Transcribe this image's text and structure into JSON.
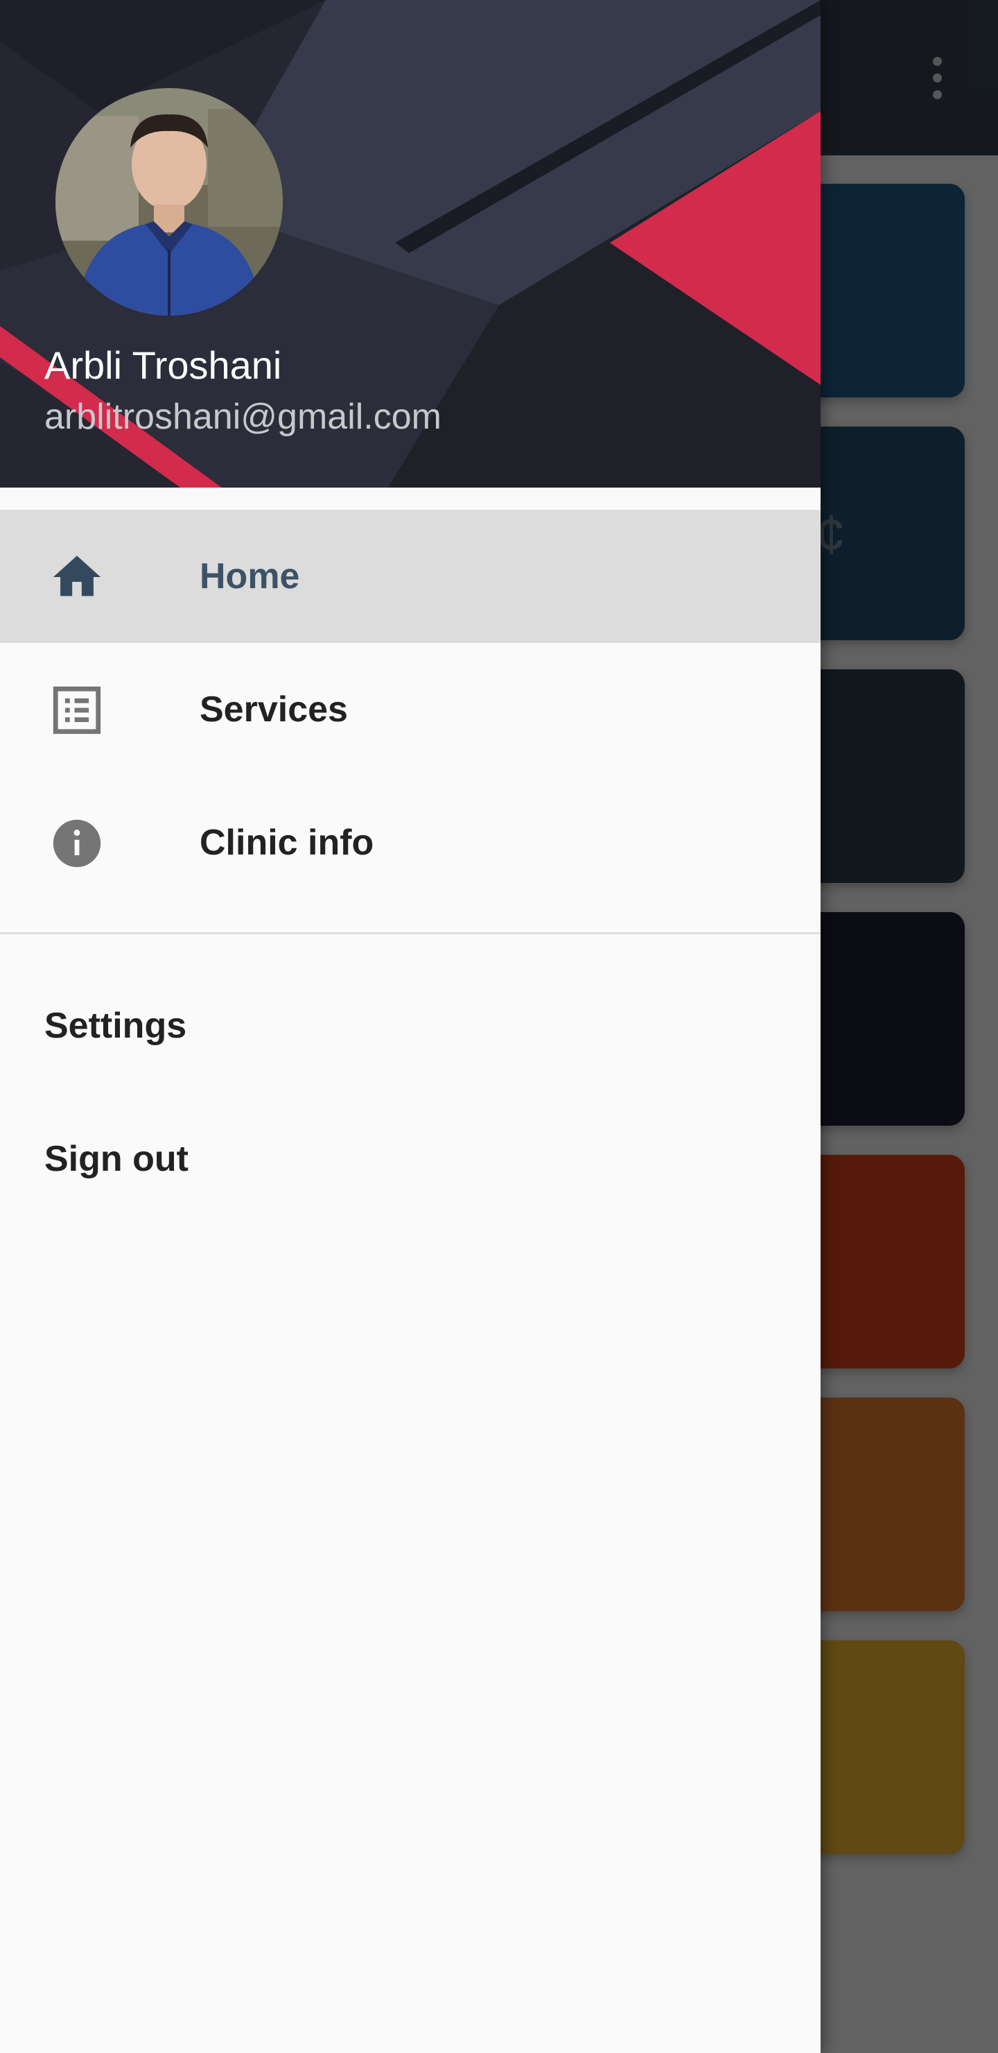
{
  "app": {
    "toolbar_color": "#35404f",
    "tiles": [
      {
        "color": "#1f5a86",
        "glyph": ""
      },
      {
        "color": "#244e6c",
        "glyph": "¢"
      },
      {
        "color": "#2d3d4c",
        "glyph": ""
      },
      {
        "color": "#1e1f33",
        "glyph": ""
      },
      {
        "color": "#d7411b",
        "glyph": ""
      },
      {
        "color": "#e07a31",
        "glyph": ""
      },
      {
        "color": "#efb630",
        "glyph": ""
      }
    ]
  },
  "drawer": {
    "user": {
      "name": "Arbli Troshani",
      "email": "arblitroshani@gmail.com"
    },
    "menu": [
      {
        "label": "Home",
        "icon": "home-icon",
        "active": true
      },
      {
        "label": "Services",
        "icon": "list-icon",
        "active": false
      },
      {
        "label": "Clinic info",
        "icon": "info-icon",
        "active": false
      }
    ],
    "secondary": [
      {
        "label": "Settings"
      },
      {
        "label": "Sign out"
      }
    ]
  },
  "colors": {
    "accent_red": "#d22b4b",
    "active_text": "#3d5266",
    "active_bg": "#dcdcdc"
  }
}
